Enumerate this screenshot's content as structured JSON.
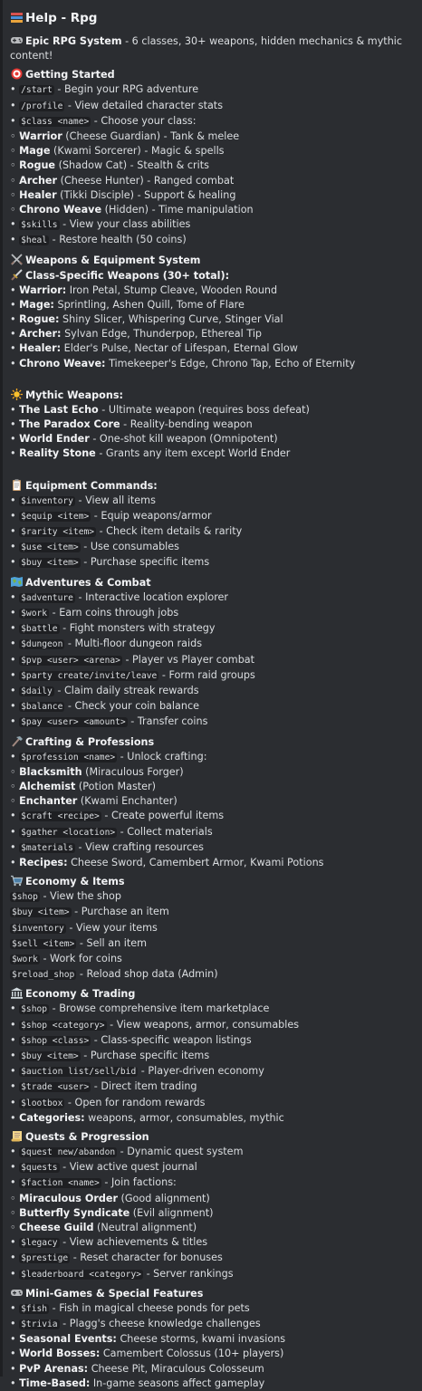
{
  "embed": {
    "title": "Help - Rpg",
    "intro_bold": "Epic RPG System",
    "intro_rest": " - 6 classes, 30+ weapons, hidden mechanics & mythic content!"
  },
  "sections": {
    "getting_started": {
      "heading": "Getting Started",
      "lines": [
        {
          "prefix": "• ",
          "code": "/start",
          "text": " - Begin your RPG adventure"
        },
        {
          "prefix": "• ",
          "code": "/profile",
          "text": " - View detailed character stats"
        },
        {
          "prefix": "• ",
          "code": "$class <name>",
          "text": " - Choose your class:"
        },
        {
          "prefix": "◦ ",
          "bold": "Warrior",
          "text": " (Cheese Guardian) - Tank & melee"
        },
        {
          "prefix": "◦ ",
          "bold": "Mage",
          "text": " (Kwami Sorcerer) - Magic & spells"
        },
        {
          "prefix": "◦ ",
          "bold": "Rogue",
          "text": " (Shadow Cat) - Stealth & crits"
        },
        {
          "prefix": "◦ ",
          "bold": "Archer",
          "text": " (Cheese Hunter) - Ranged combat"
        },
        {
          "prefix": "◦ ",
          "bold": "Healer",
          "text": " (Tikki Disciple) - Support & healing"
        },
        {
          "prefix": "◦ ",
          "bold": "Chrono Weave",
          "text": " (Hidden) - Time manipulation"
        },
        {
          "prefix": "• ",
          "code": "$skills",
          "text": " - View your class abilities"
        },
        {
          "prefix": "• ",
          "code": "$heal",
          "text": " - Restore health (50 coins)"
        }
      ]
    },
    "weapons": {
      "heading": "Weapons & Equipment System",
      "subheading": "Class-Specific Weapons (30+ total):",
      "lines": [
        {
          "prefix": "• ",
          "bold": "Warrior:",
          "text": " Iron Petal, Stump Cleave, Wooden Round"
        },
        {
          "prefix": "• ",
          "bold": "Mage:",
          "text": " Sprintling, Ashen Quill, Tome of Flare"
        },
        {
          "prefix": "• ",
          "bold": "Rogue:",
          "text": " Shiny Slicer, Whispering Curve, Stinger Vial"
        },
        {
          "prefix": "• ",
          "bold": "Archer:",
          "text": " Sylvan Edge, Thunderpop, Ethereal Tip"
        },
        {
          "prefix": "• ",
          "bold": "Healer:",
          "text": " Elder's Pulse, Nectar of Lifespan, Eternal Glow"
        },
        {
          "prefix": "• ",
          "bold": "Chrono Weave:",
          "text": " Timekeeper's Edge, Chrono Tap, Echo of Eternity"
        }
      ]
    },
    "mythic": {
      "heading": "Mythic Weapons:",
      "lines": [
        {
          "prefix": "• ",
          "bold": "The Last Echo",
          "text": " - Ultimate weapon (requires boss defeat)"
        },
        {
          "prefix": "• ",
          "bold": "The Paradox Core",
          "text": " - Reality-bending weapon"
        },
        {
          "prefix": "• ",
          "bold": "World Ender",
          "text": " - One-shot kill weapon (Omnipotent)"
        },
        {
          "prefix": "• ",
          "bold": "Reality Stone",
          "text": " - Grants any item except World Ender"
        }
      ]
    },
    "equipment": {
      "heading": "Equipment Commands:",
      "lines": [
        {
          "prefix": "• ",
          "code": "$inventory",
          "text": " - View all items"
        },
        {
          "prefix": "• ",
          "code": "$equip <item>",
          "text": " - Equip weapons/armor"
        },
        {
          "prefix": "• ",
          "code": "$rarity <item>",
          "text": " - Check item details & rarity"
        },
        {
          "prefix": "• ",
          "code": "$use <item>",
          "text": " - Use consumables"
        },
        {
          "prefix": "• ",
          "code": "$buy <item>",
          "text": " - Purchase specific items"
        }
      ]
    },
    "adventures": {
      "heading": "Adventures & Combat",
      "lines": [
        {
          "prefix": "• ",
          "code": "$adventure",
          "text": " - Interactive location explorer"
        },
        {
          "prefix": "• ",
          "code": "$work",
          "text": " - Earn coins through jobs"
        },
        {
          "prefix": "• ",
          "code": "$battle",
          "text": " - Fight monsters with strategy"
        },
        {
          "prefix": "• ",
          "code": "$dungeon",
          "text": " - Multi-floor dungeon raids"
        },
        {
          "prefix": "• ",
          "code": "$pvp <user> <arena>",
          "text": " - Player vs Player combat"
        },
        {
          "prefix": "• ",
          "code": "$party create/invite/leave",
          "text": " - Form raid groups"
        },
        {
          "prefix": "• ",
          "code": "$daily",
          "text": " - Claim daily streak rewards"
        },
        {
          "prefix": "• ",
          "code": "$balance",
          "text": " - Check your coin balance"
        },
        {
          "prefix": "• ",
          "code": "$pay <user> <amount>",
          "text": " - Transfer coins"
        }
      ]
    },
    "crafting": {
      "heading": "Crafting & Professions",
      "lines": [
        {
          "prefix": "• ",
          "code": "$profession <name>",
          "text": " - Unlock crafting:"
        },
        {
          "prefix": "◦ ",
          "bold": "Blacksmith",
          "text": " (Miraculous Forger)"
        },
        {
          "prefix": "◦ ",
          "bold": "Alchemist",
          "text": " (Potion Master)"
        },
        {
          "prefix": "◦ ",
          "bold": "Enchanter",
          "text": " (Kwami Enchanter)"
        },
        {
          "prefix": "• ",
          "code": "$craft <recipe>",
          "text": " - Create powerful items"
        },
        {
          "prefix": "• ",
          "code": "$gather <location>",
          "text": " - Collect materials"
        },
        {
          "prefix": "• ",
          "code": "$materials",
          "text": " - View crafting resources"
        },
        {
          "prefix": "• ",
          "bold": "Recipes:",
          "text": " Cheese Sword, Camembert Armor, Kwami Potions"
        }
      ]
    },
    "economy_items": {
      "heading": "Economy & Items",
      "lines": [
        {
          "prefix": "",
          "code": "$shop",
          "text": " - View the shop"
        },
        {
          "prefix": "",
          "code": "$buy <item>",
          "text": " - Purchase an item"
        },
        {
          "prefix": "",
          "code": "$inventory",
          "text": " - View your items"
        },
        {
          "prefix": "",
          "code": "$sell <item>",
          "text": " - Sell an item"
        },
        {
          "prefix": "",
          "code": "$work",
          "text": " - Work for coins"
        },
        {
          "prefix": "",
          "code": "$reload_shop",
          "text": " - Reload shop data (Admin)"
        }
      ]
    },
    "economy_trading": {
      "heading": "Economy & Trading",
      "lines": [
        {
          "prefix": "• ",
          "code": "$shop",
          "text": " - Browse comprehensive item marketplace"
        },
        {
          "prefix": "• ",
          "code": "$shop <category>",
          "text": " - View weapons, armor, consumables"
        },
        {
          "prefix": "• ",
          "code": "$shop <class>",
          "text": " - Class-specific weapon listings"
        },
        {
          "prefix": "• ",
          "code": "$buy <item>",
          "text": " - Purchase specific items"
        },
        {
          "prefix": "• ",
          "code": "$auction list/sell/bid",
          "text": " - Player-driven economy"
        },
        {
          "prefix": "• ",
          "code": "$trade <user>",
          "text": " - Direct item trading"
        },
        {
          "prefix": "• ",
          "code": "$lootbox",
          "text": " - Open for random rewards"
        },
        {
          "prefix": "• ",
          "bold": "Categories:",
          "text": " weapons, armor, consumables, mythic"
        }
      ]
    },
    "quests": {
      "heading": "Quests & Progression",
      "lines": [
        {
          "prefix": "• ",
          "code": "$quest new/abandon",
          "text": " - Dynamic quest system"
        },
        {
          "prefix": "• ",
          "code": "$quests",
          "text": " - View active quest journal"
        },
        {
          "prefix": "• ",
          "code": "$faction <name>",
          "text": " - Join factions:"
        },
        {
          "prefix": "◦ ",
          "bold": "Miraculous Order",
          "text": " (Good alignment)"
        },
        {
          "prefix": "◦ ",
          "bold": "Butterfly Syndicate",
          "text": " (Evil alignment)"
        },
        {
          "prefix": "◦ ",
          "bold": "Cheese Guild",
          "text": " (Neutral alignment)"
        },
        {
          "prefix": "• ",
          "code": "$legacy",
          "text": " - View achievements & titles"
        },
        {
          "prefix": "• ",
          "code": "$prestige",
          "text": " - Reset character for bonuses"
        },
        {
          "prefix": "• ",
          "code": "$leaderboard <category>",
          "text": " - Server rankings"
        }
      ]
    },
    "minigames": {
      "heading": "Mini-Games & Special Features",
      "lines": [
        {
          "prefix": "• ",
          "code": "$fish",
          "text": " - Fish in magical cheese ponds for pets"
        },
        {
          "prefix": "• ",
          "code": "$trivia",
          "text": " - Plagg's cheese knowledge challenges"
        },
        {
          "prefix": "• ",
          "bold": "Seasonal Events:",
          "text": " Cheese storms, kwami invasions"
        },
        {
          "prefix": "• ",
          "bold": "World Bosses:",
          "text": " Camembert Colossus (10+ players)"
        },
        {
          "prefix": "• ",
          "bold": "PvP Arenas:",
          "text": " Cheese Pit, Miraculous Colosseum"
        },
        {
          "prefix": "• ",
          "bold": "Time-Based:",
          "text": " In-game seasons affect gameplay"
        }
      ]
    }
  },
  "icons": {
    "title": "books-icon",
    "intro": "game-controller-icon",
    "getting_started": "direct-hit-icon",
    "weapons": "crossed-swords-icon",
    "class_weapons": "dagger-icon",
    "mythic": "sun-icon",
    "equipment": "clipboard-icon",
    "adventures": "world-map-icon",
    "crafting": "hammer-icon",
    "economy_items": "shopping-cart-icon",
    "economy_trading": "bank-icon",
    "quests": "scroll-icon",
    "minigames": "game-controller-icon"
  },
  "colors": {
    "background": "#2b2d31",
    "text": "#dbdee1",
    "bold_text": "#f2f3f5",
    "code_background": "#1e1f22"
  }
}
